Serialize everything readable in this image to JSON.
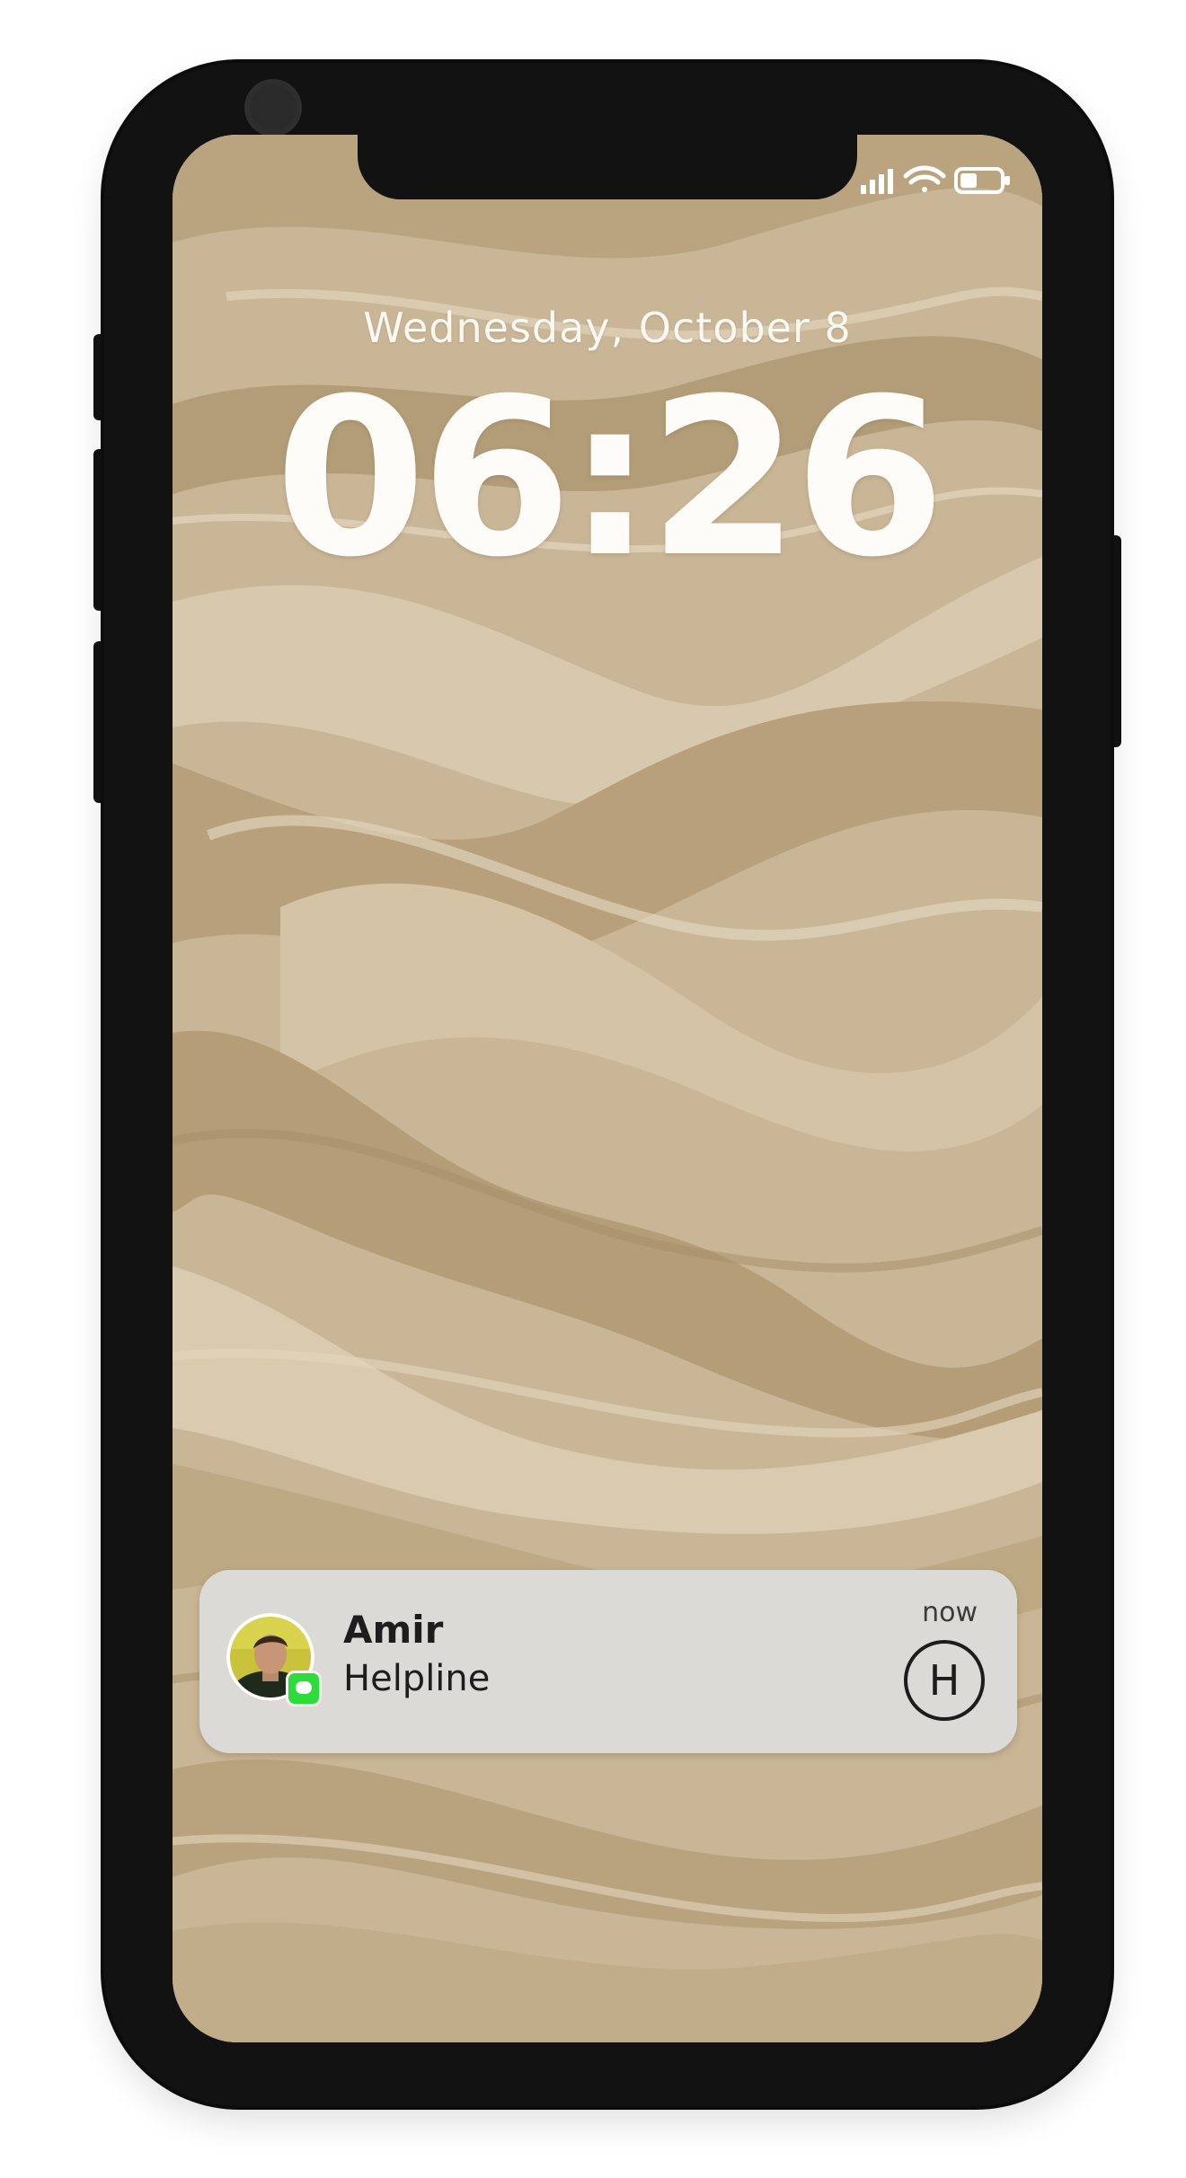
{
  "lock_screen": {
    "date": "Wednesday, October 8",
    "time": "06:26"
  },
  "status_bar": {
    "icons": [
      "signal-bars-icon",
      "wifi-icon",
      "battery-icon"
    ]
  },
  "notification": {
    "sender": "Amir",
    "message": "Helpline",
    "time": "now",
    "app_icon": "messages-icon",
    "action_icon_letter": "H"
  },
  "colors": {
    "wallpaper_base": "#c8b596",
    "notification_bg": "#dcdad6",
    "frame": "#121212",
    "messages_green": "#2ddb3a"
  }
}
